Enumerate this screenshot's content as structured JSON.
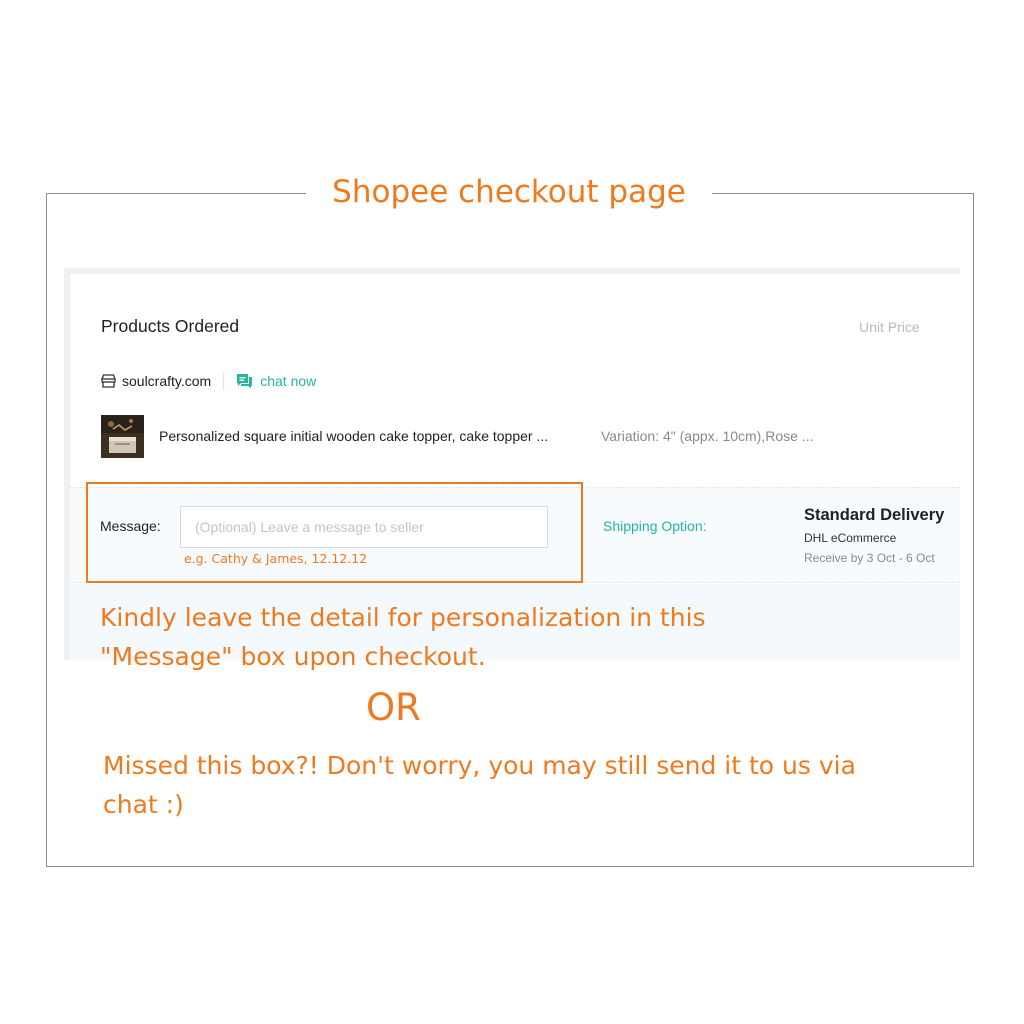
{
  "frame_title": "Shopee checkout page",
  "products": {
    "heading": "Products Ordered",
    "unit_price_header": "Unit Price"
  },
  "shop": {
    "name": "soulcrafty.com",
    "chat_label": "chat now"
  },
  "item": {
    "name": "Personalized square initial wooden cake topper, cake topper ...",
    "variation": "Variation: 4\" (appx. 10cm),Rose ..."
  },
  "message": {
    "label": "Message:",
    "placeholder": "(Optional) Leave a message to seller",
    "value": "",
    "hint": "e.g. Cathy & James, 12.12.12"
  },
  "shipping": {
    "label": "Shipping Option:",
    "method": "Standard Delivery",
    "carrier": "DHL eCommerce",
    "eta": "Receive by 3 Oct - 6 Oct"
  },
  "notes": {
    "line1": "Kindly leave the detail for personalization in this \"Message\" box upon checkout.",
    "or": "OR",
    "line2": "Missed this box?! Don't worry, you may still send it to us via chat :)"
  },
  "colors": {
    "annotation_orange": "#ef7a1e",
    "shopee_teal": "#25b5a1"
  },
  "icons": {
    "shop": "shop-icon",
    "chat": "chat-icon"
  }
}
